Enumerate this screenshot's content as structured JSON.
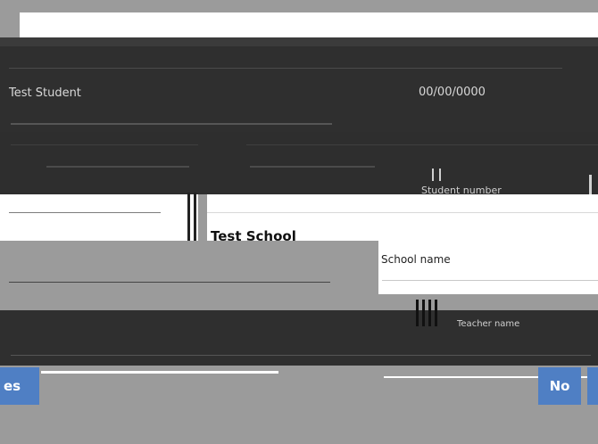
{
  "student": {
    "name": "Test Student",
    "date": "00/00/0000",
    "student_number_label": "Student number"
  },
  "school": {
    "name": "Test School",
    "name_label": "School name",
    "teacher_label": "Teacher name"
  },
  "buttons": {
    "yes_label": "es",
    "no_label": "No"
  }
}
